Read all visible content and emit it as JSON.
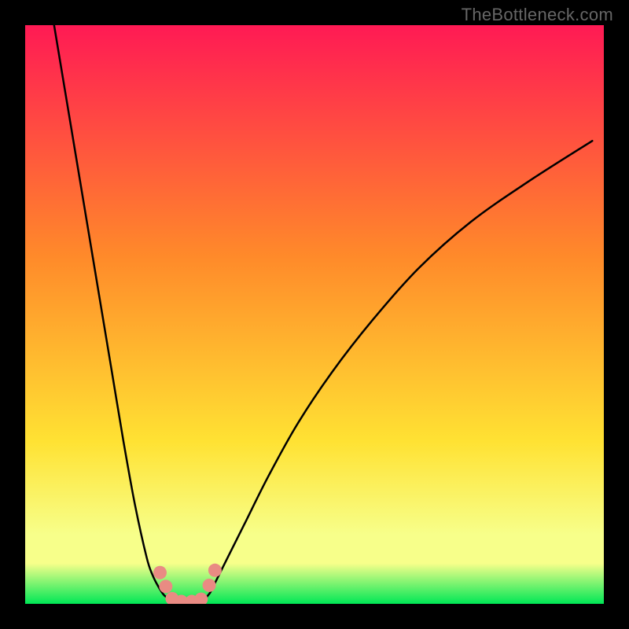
{
  "watermark": "TheBottleneck.com",
  "chart_data": {
    "type": "line",
    "title": "",
    "xlabel": "",
    "ylabel": "",
    "xlim": [
      0,
      100
    ],
    "ylim": [
      0,
      100
    ],
    "series": [
      {
        "name": "curve-left",
        "x": [
          5,
          7,
          9,
          11,
          13,
          15,
          17,
          19,
          21,
          22,
          23,
          24,
          25
        ],
        "values": [
          100,
          88,
          76,
          64,
          52,
          40,
          28,
          17,
          8,
          5,
          3,
          1.5,
          0.8
        ]
      },
      {
        "name": "curve-right",
        "x": [
          31,
          32,
          33,
          35,
          38,
          42,
          47,
          53,
          60,
          68,
          77,
          87,
          98
        ],
        "values": [
          0.8,
          2,
          4,
          8,
          14,
          22,
          31,
          40,
          49,
          58,
          66,
          73,
          80
        ]
      },
      {
        "name": "trough",
        "x": [
          25,
          26,
          27,
          28,
          29,
          30,
          31
        ],
        "values": [
          0.8,
          0.3,
          0.2,
          0.2,
          0.2,
          0.3,
          0.8
        ]
      }
    ],
    "markers": [
      {
        "name": "dot-left-upper",
        "x": 23.3,
        "y": 5.4
      },
      {
        "name": "dot-left-lower",
        "x": 24.3,
        "y": 3.0
      },
      {
        "name": "dot-mid-a",
        "x": 25.4,
        "y": 0.9
      },
      {
        "name": "dot-mid-b",
        "x": 27.0,
        "y": 0.4
      },
      {
        "name": "dot-mid-c",
        "x": 28.8,
        "y": 0.4
      },
      {
        "name": "dot-mid-d",
        "x": 30.4,
        "y": 0.8
      },
      {
        "name": "dot-right-lower",
        "x": 31.8,
        "y": 3.2
      },
      {
        "name": "dot-right-upper",
        "x": 32.8,
        "y": 5.8
      }
    ],
    "colors": {
      "gradient_top": "#ff1a54",
      "gradient_mid1": "#ff8a2a",
      "gradient_mid2": "#ffe233",
      "gradient_band": "#f7ff8a",
      "gradient_base": "#00e756",
      "curve": "#000000",
      "marker": "#e98b83"
    }
  }
}
